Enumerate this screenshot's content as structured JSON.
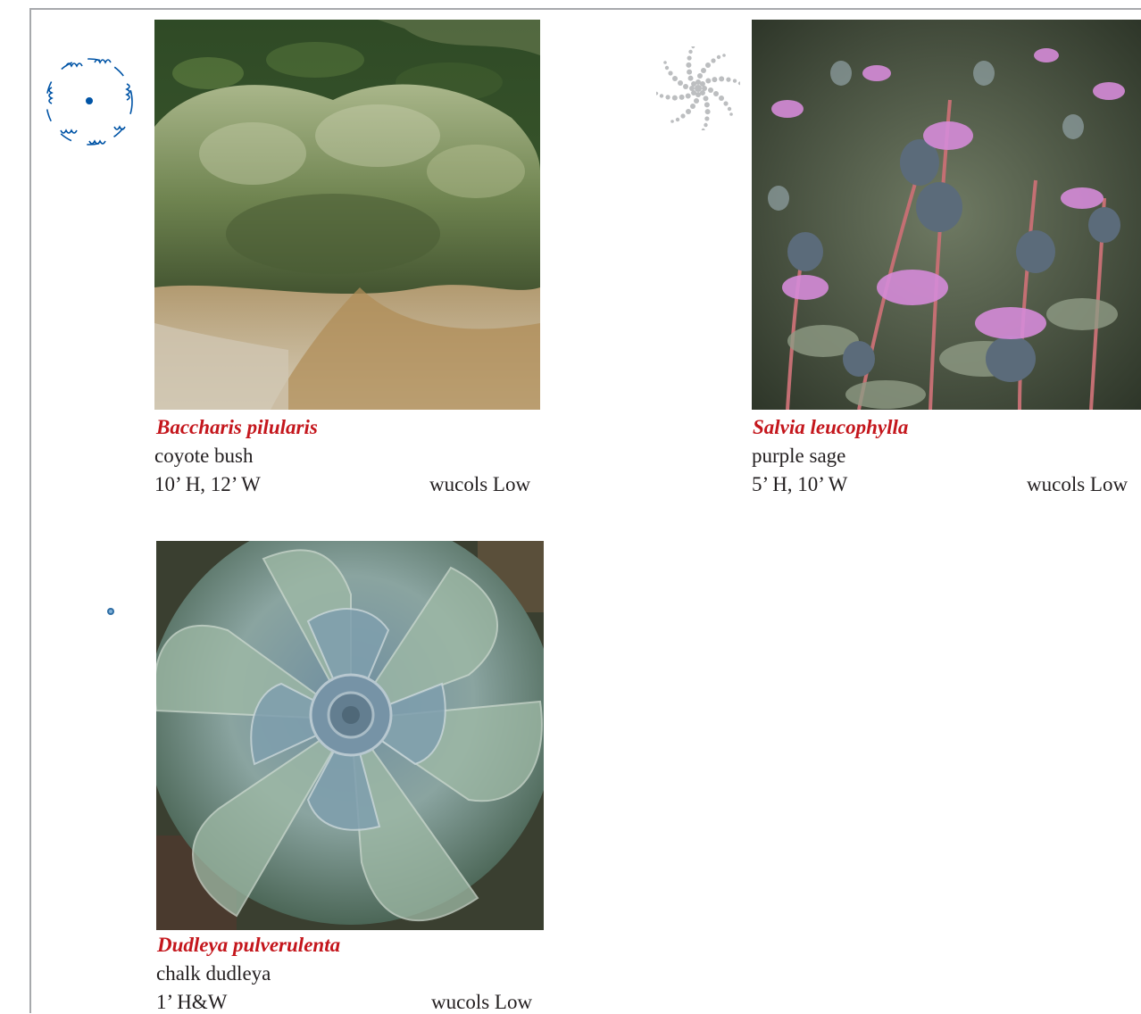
{
  "plants": [
    {
      "latin": "Baccharis pilularis",
      "common": "coyote bush",
      "size": "10’ H, 12’ W",
      "wucols": "wucols Low",
      "symbol": "shrub-outline-symbol",
      "symbol_color": "#0054a6"
    },
    {
      "latin": "Salvia leucophylla",
      "common": "purple sage",
      "size": "5’ H, 10’ W",
      "wucols": "wucols Low",
      "symbol": "spiral-leaf-symbol",
      "symbol_color": "#bcbec0"
    },
    {
      "latin": "Dudleya pulverulenta",
      "common": "chalk dudleya",
      "size": "1’ H&W",
      "wucols": "wucols Low",
      "symbol": "small-dot-symbol",
      "symbol_color": "#2e6da4"
    }
  ],
  "colors": {
    "latin_name": "#c4161c",
    "frame": "#a7a9ac"
  }
}
